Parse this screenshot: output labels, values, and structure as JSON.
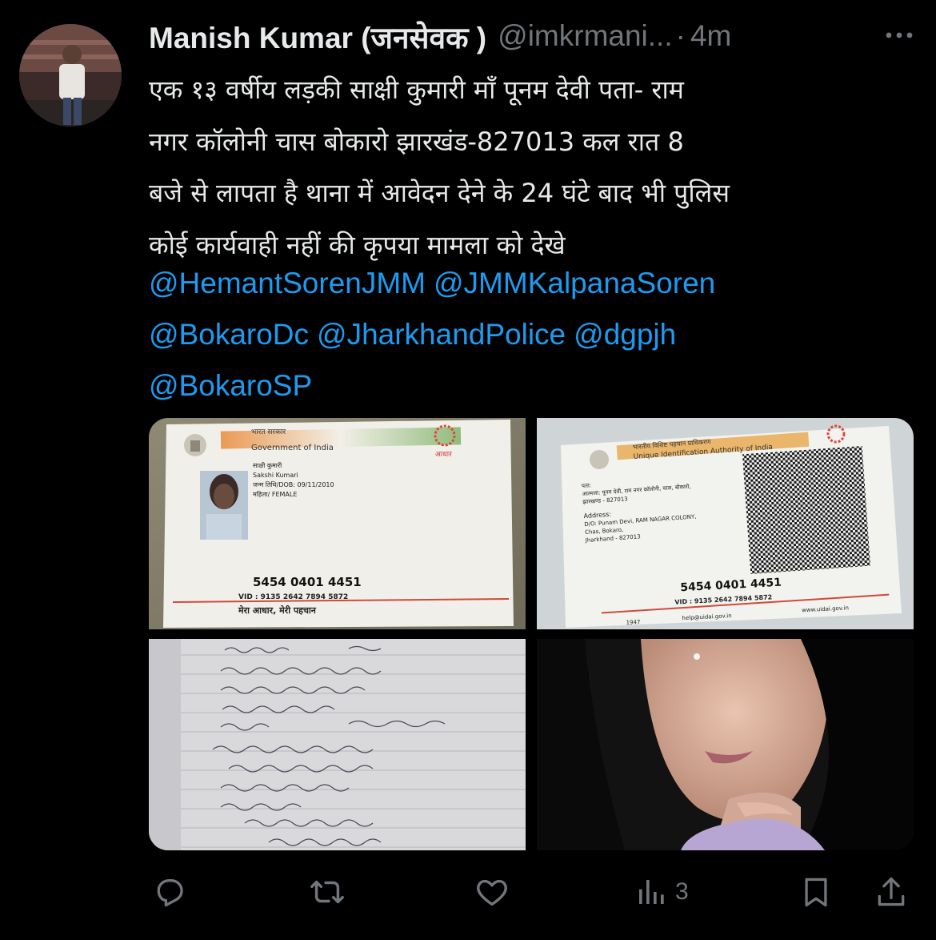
{
  "tweet": {
    "author": {
      "display_name": "Manish Kumar (जनसेवक )",
      "handle": "@imkrmani...",
      "separator": "·",
      "time": "4m"
    },
    "text": "एक १३ वर्षीय लड़की साक्षी कुमारी माँ पूनम देवी पता- राम\nनगर कॉलोनी चास बोकारो झारखंड-827013 कल रात 8\nबजे से लापता है थाना में आवेदन देने के 24 घंटे बाद भी पुलिस\nकोई कार्यवाही नहीं की कृपया मामला को देखे",
    "mentions": [
      "@HemantSorenJMM",
      "@JMMKalpanaSoren",
      "@BokaroDc",
      "@JharkhandPolice",
      "@dgpjh",
      "@BokaroSP"
    ],
    "media": {
      "card_front": {
        "header_hindi": "भारत सरकार",
        "header_english": "Government of India",
        "name_hindi": "साक्षी कुमारी",
        "name_english": "Sakshi Kumari",
        "dob": "जन्म तिथि/DOB: 09/11/2010",
        "gender": "महिला/ FEMALE",
        "number": "5454 0401 4451",
        "vid": "VID : 9135 2642 7894 5872",
        "footer": "मेरा आधार, मेरी पहचान"
      },
      "card_back": {
        "header_hindi": "भारतीय विशिष्ट पहचान प्राधिकरण",
        "header_english": "Unique Identification Authority of India",
        "address_hindi_1": "पता:",
        "address_hindi_2": "आत्मजा: पूनम देवी, राम नगर कॉलोनी, चास, बोकारो,",
        "address_hindi_3": "झारखण्ड - 827013",
        "address_label": "Address:",
        "address_1": "D/O: Punam Devi, RAM NAGAR COLONY,",
        "address_2": "Chas, Bokaro,",
        "address_3": "Jharkhand - 827013",
        "number": "5454 0401 4451",
        "vid": "VID : 9135 2642 7894 5872",
        "phone": "1947",
        "email": "help@uidai.gov.in",
        "web": "www.uidai.gov.in"
      }
    },
    "stats": {
      "views": "3"
    }
  },
  "colors": {
    "background": "#000000",
    "text": "#e7e9ea",
    "secondary": "#71767b",
    "link": "#1d9bf0"
  },
  "icons": {
    "more": "more-horizontal-icon",
    "reply": "reply-bubble-icon",
    "retweet": "retweet-icon",
    "like": "heart-icon",
    "views": "bar-chart-icon",
    "bookmark": "bookmark-icon",
    "share": "share-upload-icon"
  }
}
